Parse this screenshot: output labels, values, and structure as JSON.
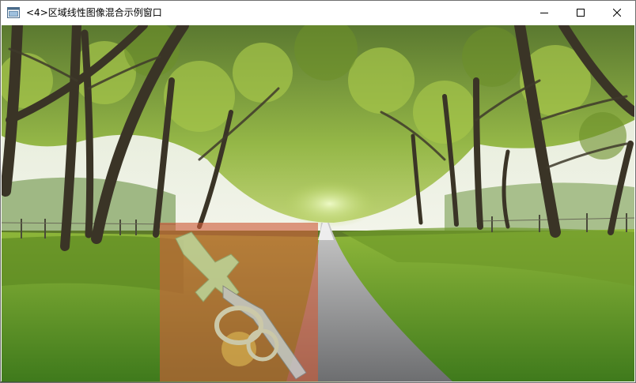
{
  "window": {
    "title": "<4>区域线性图像混合示例窗口",
    "app_icon": "window-app-icon",
    "controls": {
      "minimize_icon": "minimize-icon",
      "maximize_icon": "maximize-icon",
      "close_icon": "close-icon"
    }
  },
  "canvas": {
    "image_subject": "photo",
    "overlay_icon": "sword-emblem-icon",
    "overlay_blend_weight": 0.5,
    "overlay_color": "#d23c28"
  }
}
